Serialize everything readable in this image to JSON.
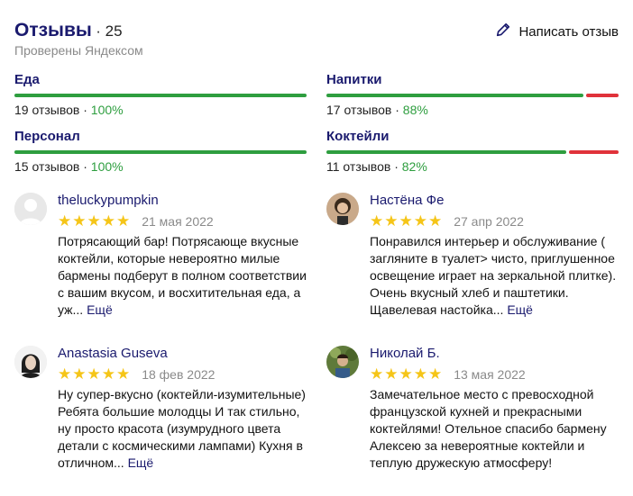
{
  "header": {
    "title": "Отзывы",
    "count": "· 25",
    "subtitle": "Проверены Яндексом",
    "write_label": "Написать отзыв",
    "write_icon": "pencil-icon"
  },
  "categories": [
    {
      "name": "Еда",
      "reviews": "19 отзывов",
      "sep": " · ",
      "percent": "100%",
      "positive": 1.0
    },
    {
      "name": "Напитки",
      "reviews": "17 отзывов",
      "sep": " · ",
      "percent": "88%",
      "positive": 0.88
    },
    {
      "name": "Персонал",
      "reviews": "15 отзывов",
      "sep": " · ",
      "percent": "100%",
      "positive": 1.0
    },
    {
      "name": "Коктейли",
      "reviews": "11 отзывов",
      "sep": " · ",
      "percent": "82%",
      "positive": 0.82
    }
  ],
  "reviews": [
    {
      "author": "theluckypumpkin",
      "stars": "★★★★★",
      "rating": 5,
      "date": "21 мая 2022",
      "text": "Потрясающий бар! Потрясающе вкусные коктейли, которые невероятно милые бармены подберут в полном соответствии с вашим вкусом, и восхитительная еда, а уж...",
      "more": "Ещё"
    },
    {
      "author": "Настёна Фе",
      "stars": "★★★★★",
      "rating": 5,
      "date": "27 апр 2022",
      "text": "Понравился интерьер и обслуживание ( загляните в туалет> чисто, приглушенное освещение играет на зеркальной плитке). Очень вкусный хлеб и паштетики. Щавелевая настойка...",
      "more": "Ещё"
    },
    {
      "author": "Anastasia Guseva",
      "stars": "★★★★★",
      "rating": 5,
      "date": "18 фев 2022",
      "text": "Ну супер-вкусно (коктейли-изумительные) Ребята большие молодцы И так стильно, ну просто красота (изумрудного цвета детали с космическими лампами) Кухня в отличном...",
      "more": "Ещё"
    },
    {
      "author": "Николай Б.",
      "stars": "★★★★★",
      "rating": 5,
      "date": "13 мая 2022",
      "text": "Замечательное место с превосходной французской кухней и прекрасными коктейлями! Отельное спасибо бармену Алексею за невероятные коктейли и теплую дружескую атмосферу!",
      "more": ""
    }
  ],
  "colors": {
    "accent": "#1a1a6e",
    "positive": "#2e9e3f",
    "negative": "#e0323a",
    "star": "#f5c518",
    "muted": "#8a8a8a"
  }
}
